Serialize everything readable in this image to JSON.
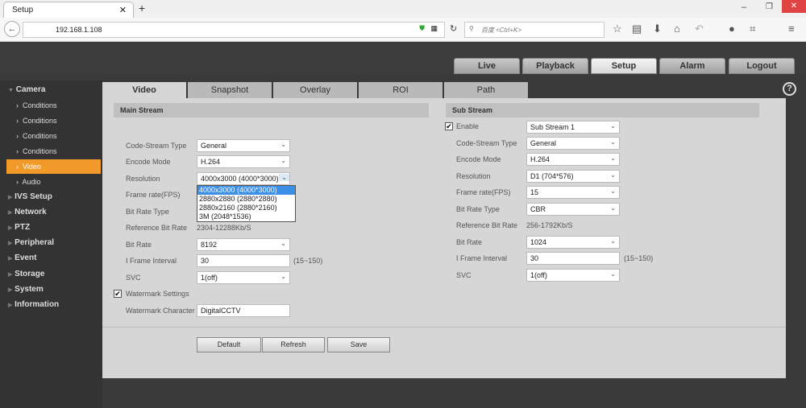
{
  "browser": {
    "tab_title": "Setup",
    "new_tab": "+",
    "url": "192.168.1.108",
    "search_placeholder": "百度 <Ctrl+K>"
  },
  "nav": [
    "Live",
    "Playback",
    "Setup",
    "Alarm",
    "Logout"
  ],
  "sidebar": {
    "camera": "Camera",
    "camera_items": [
      "Conditions",
      "Conditions",
      "Conditions",
      "Conditions",
      "Video",
      "Audio"
    ],
    "sections": [
      "IVS Setup",
      "Network",
      "PTZ",
      "Peripheral",
      "Event",
      "Storage",
      "System",
      "Information"
    ]
  },
  "tabs": [
    "Video",
    "Snapshot",
    "Overlay",
    "ROI",
    "Path"
  ],
  "help": "?",
  "main": {
    "title": "Main Stream",
    "labels": [
      "Code-Stream Type",
      "Encode Mode",
      "Resolution",
      "Frame rate(FPS)",
      "Bit Rate Type",
      "Reference Bit Rate",
      "Bit Rate",
      "I Frame Interval",
      "SVC"
    ],
    "code_stream_type": "General",
    "encode_mode": "H.264",
    "resolution": "4000x3000 (4000*3000)",
    "reference_bit_rate": "2304-12288Kb/S",
    "bit_rate": "8192",
    "iframe_interval": "30",
    "iframe_range": "(15~150)",
    "svc": "1(off)",
    "resolution_options": [
      "4000x3000 (4000*3000)",
      "2880x2880 (2880*2880)",
      "2880x2160 (2880*2160)",
      "3M (2048*1536)"
    ],
    "watermark_settings": "Watermark Settings",
    "watermark_character_label": "Watermark Character",
    "watermark_character": "DigitalCCTV"
  },
  "sub": {
    "title": "Sub Stream",
    "enable": "Enable",
    "stream": "Sub Stream 1",
    "labels": [
      "Code-Stream Type",
      "Encode Mode",
      "Resolution",
      "Frame rate(FPS)",
      "Bit Rate Type",
      "Reference Bit Rate",
      "Bit Rate",
      "I Frame Interval",
      "SVC"
    ],
    "code_stream_type": "General",
    "encode_mode": "H.264",
    "resolution": "D1 (704*576)",
    "frame_rate": "15",
    "bit_rate_type": "CBR",
    "reference_bit_rate": "256-1792Kb/S",
    "bit_rate": "1024",
    "iframe_interval": "30",
    "iframe_range": "(15~150)",
    "svc": "1(off)"
  },
  "buttons": {
    "default": "Default",
    "refresh": "Refresh",
    "save": "Save"
  },
  "colors": {
    "accent": "#f19a2a",
    "highlight": "#3b8fe6"
  }
}
